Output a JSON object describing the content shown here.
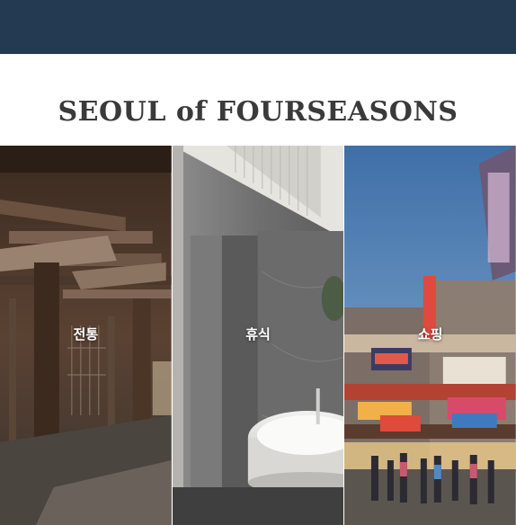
{
  "header": {
    "color": "#233a52"
  },
  "section": {
    "title": "SEOUL of FOURSEASONS"
  },
  "tiles": [
    {
      "label": "전통",
      "image": "traditional-hanok-photo"
    },
    {
      "label": "휴식",
      "image": "bathroom-bathtub-photo"
    },
    {
      "label": "쇼핑",
      "image": "shopping-street-photo"
    }
  ]
}
